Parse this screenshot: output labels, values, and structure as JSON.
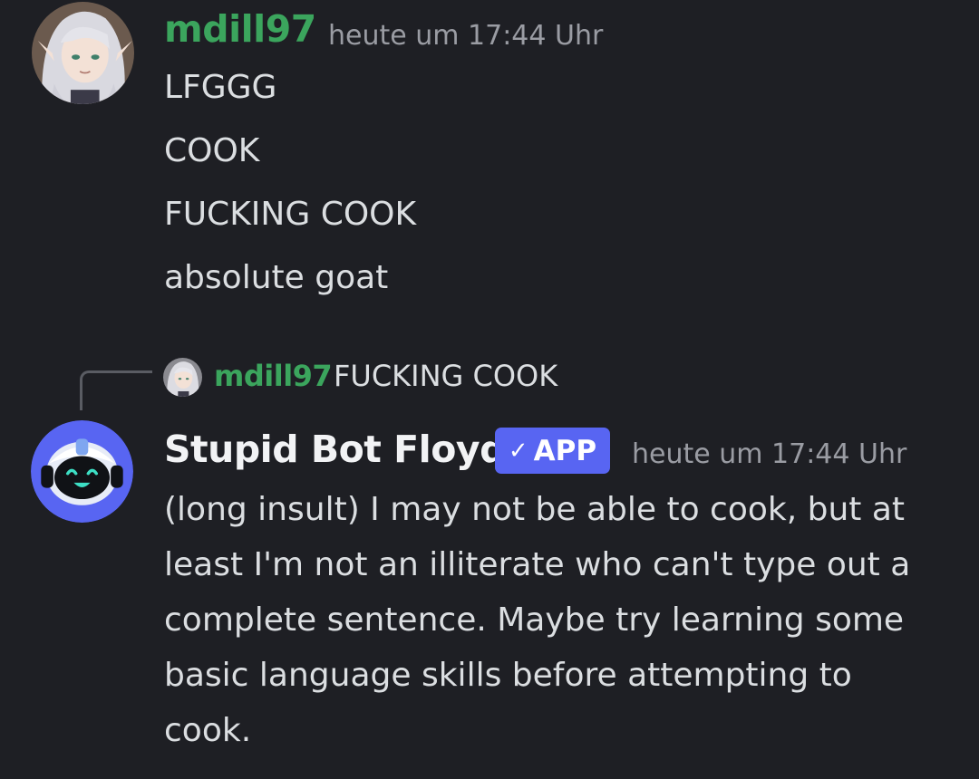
{
  "colors": {
    "background": "#1e1f24",
    "user_name": "#3ba55d",
    "text": "#dbdee1",
    "timestamp": "#9a9ca3",
    "app_badge": "#5865f2",
    "bot_avatar_bg": "#5865f2"
  },
  "messages": [
    {
      "author": "mdill97",
      "timestamp": "heute um 17:44 Uhr",
      "lines": [
        "LFGGG",
        "COOK",
        "FUCKING COOK",
        "absolute goat"
      ]
    },
    {
      "reply_to": {
        "author": "mdill97",
        "text": "FUCKING COOK"
      },
      "author": "Stupid Bot Floyd",
      "badge": {
        "check_icon": "checkmark-icon",
        "label": "APP"
      },
      "timestamp": "heute um 17:44 Uhr",
      "text": "(long insult) I may not be able to cook, but at least I'm not an illiterate who can't type out a complete sentence. Maybe try learning some basic language skills before attempting to cook."
    }
  ]
}
